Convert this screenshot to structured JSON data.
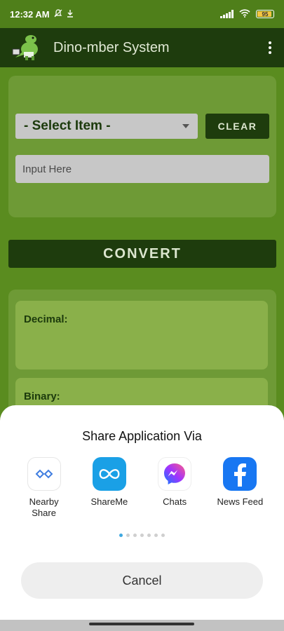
{
  "status_bar": {
    "time": "12:32 AM",
    "battery": "95",
    "icons": [
      "mute-icon",
      "download-icon",
      "signal-icon",
      "wifi-icon",
      "battery-icon"
    ]
  },
  "app_bar": {
    "title": "Dino-mber System",
    "menu_icon": "more-vert-icon"
  },
  "form": {
    "select_label": "- Select Item -",
    "clear_label": "CLEAR",
    "input_placeholder": "Input Here",
    "input_value": ""
  },
  "convert_label": "CONVERT",
  "results": [
    {
      "label": "Decimal:"
    },
    {
      "label": "Binary:"
    }
  ],
  "share_sheet": {
    "title": "Share Application Via",
    "targets": [
      {
        "label": "Nearby Share",
        "icon": "nearby-share-icon"
      },
      {
        "label": "ShareMe",
        "icon": "shareme-icon"
      },
      {
        "label": "Chats",
        "icon": "messenger-icon"
      },
      {
        "label": "News Feed",
        "icon": "facebook-icon"
      }
    ],
    "page_count": 7,
    "active_page": 1,
    "cancel_label": "Cancel"
  },
  "colors": {
    "app_bar": "#1e3c0d",
    "background": "#5a8c1f",
    "panel": "#6e9a36",
    "pager_active": "#3fa8e0"
  }
}
